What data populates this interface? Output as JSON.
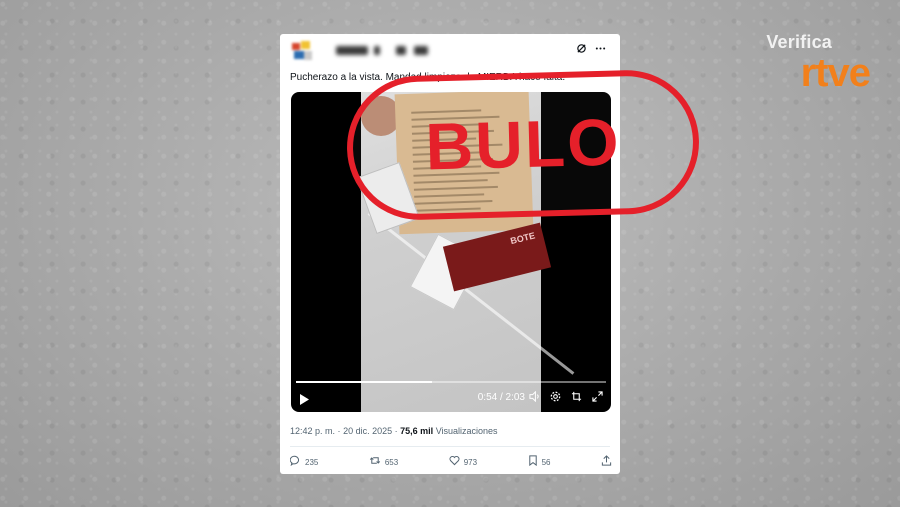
{
  "brand": {
    "verifica": "Verifica",
    "rtve": "rtve",
    "accent": "#f2801b"
  },
  "stamp": {
    "text": "BULO",
    "color": "#e5202a"
  },
  "tweet": {
    "text": "Pucherazo a la vista. Mandad limpieza de MIERDA hace falta.",
    "video": {
      "time": "0:54 / 2:03",
      "progress_fraction": 0.44,
      "leaflet_text": "BOTE"
    },
    "meta": {
      "time": "12:42 p. m.",
      "sep1": "·",
      "date": "20 dic. 2025",
      "sep2": "·",
      "views_count": "75,6 mil",
      "views_label": "Visualizaciones"
    },
    "actions": {
      "replies": "235",
      "retweets": "653",
      "likes": "973",
      "bookmarks": "56"
    }
  },
  "icons": {
    "grok": "grok-icon",
    "more": "more-icon",
    "play": "play-icon",
    "volume": "volume-icon",
    "settings": "settings-icon",
    "pip": "pip-icon",
    "fullscreen": "fullscreen-icon",
    "reply": "reply-icon",
    "retweet": "retweet-icon",
    "like": "heart-icon",
    "bookmark": "bookmark-icon",
    "share": "share-icon"
  }
}
